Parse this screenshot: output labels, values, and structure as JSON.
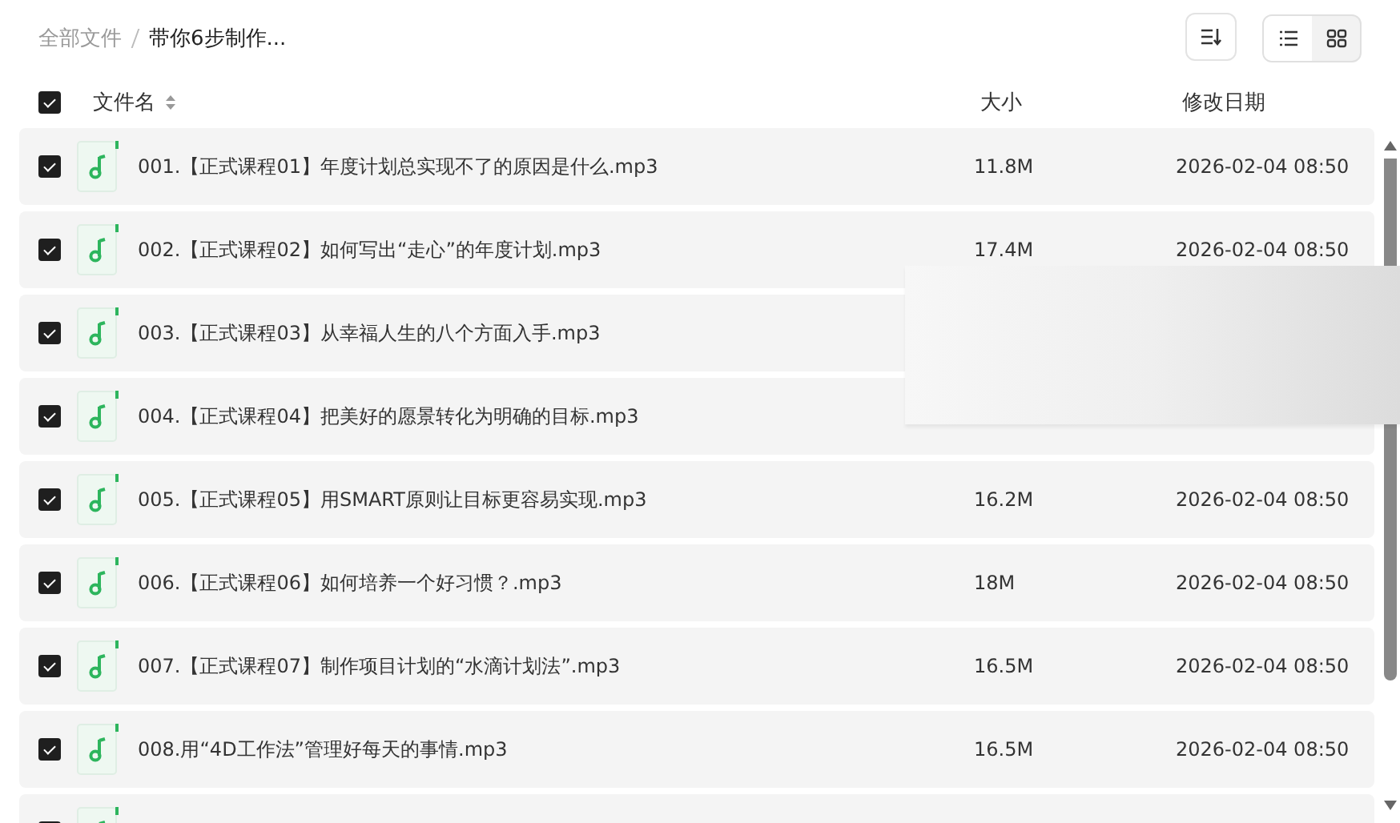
{
  "breadcrumb": [
    {
      "label": "全部文件",
      "current": false
    },
    {
      "label": "带你6步制作...",
      "current": true
    }
  ],
  "view_toggle": [
    {
      "kind": "list",
      "selected": true
    },
    {
      "kind": "grid",
      "selected": false
    }
  ],
  "header": {
    "checked": true,
    "name": "文件名",
    "size": "大小",
    "date": "修改日期"
  },
  "rows": [
    {
      "checked": true,
      "name": "001.【正式课程01】年度计划总实现不了的原因是什么.mp3",
      "size": "11.8M",
      "date": "2026-02-04 08:50"
    },
    {
      "checked": true,
      "name": "002.【正式课程02】如何写出“走心”的年度计划.mp3",
      "size": "17.4M",
      "date": "2026-02-04 08:50"
    },
    {
      "checked": true,
      "name": "003.【正式课程03】从幸福人生的八个方面入手.mp3"
    },
    {
      "checked": true,
      "name": "004.【正式课程04】把美好的愿景转化为明确的目标.mp3"
    },
    {
      "checked": true,
      "name": "005.【正式课程05】用SMART原则让目标更容易实现.mp3",
      "size": "16.2M",
      "date": "2026-02-04 08:50"
    },
    {
      "checked": true,
      "name": "006.【正式课程06】如何培养一个好习惯？.mp3",
      "size": "18M",
      "date": "2026-02-04 08:50"
    },
    {
      "checked": true,
      "name": "007.【正式课程07】制作项目计划的“水滴计划法”.mp3",
      "size": "16.5M",
      "date": "2026-02-04 08:50"
    },
    {
      "checked": true,
      "name": "008.用“4D工作法”管理好每天的事情.mp3",
      "size": "16.5M",
      "date": "2026-02-04 08:50"
    },
    {
      "checked": true
    }
  ]
}
